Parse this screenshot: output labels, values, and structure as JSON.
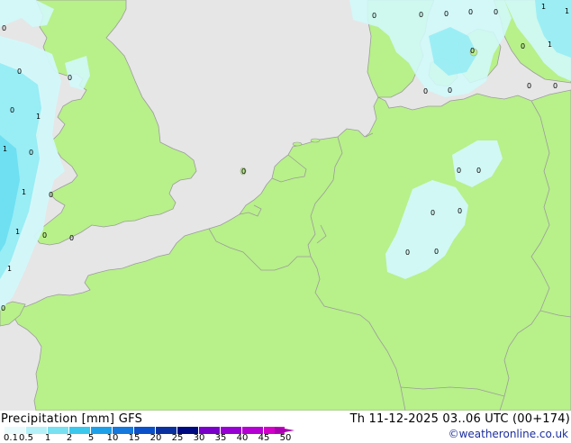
{
  "map": {
    "colors": {
      "sea": "#e6e6e6",
      "land": "#b8f08a",
      "border": "#9c9c9c",
      "precip_light": "#d2f8fa",
      "precip_medium": "#96ecf4",
      "precip_heavy": "#6cdff0"
    },
    "value_labels": [
      "1",
      "1",
      "1",
      "1",
      "1",
      "1",
      "1",
      "1",
      "0",
      "0",
      "0",
      "0",
      "0",
      "0",
      "0",
      "0",
      "0",
      "0",
      "0",
      "0",
      "0",
      "0",
      "0",
      "0",
      "0",
      "0",
      "0",
      "0",
      "0",
      "0"
    ]
  },
  "footer": {
    "title_left": "Precipitation [mm]  GFS",
    "title_right": "Th 11-12-2025 03..06 UTC (00+174)",
    "credit": "©weatheronline.co.uk",
    "scale": {
      "labels": [
        "0.1",
        "0.5",
        "1",
        "2",
        "5",
        "10",
        "15",
        "20",
        "25",
        "30",
        "35",
        "40",
        "45",
        "50"
      ],
      "colors": [
        "#e8fafc",
        "#b4f0f8",
        "#78e0f0",
        "#3cc8ec",
        "#1ea0e8",
        "#1478dc",
        "#0a50c8",
        "#0a30a0",
        "#000a80",
        "#7800c8",
        "#9600d2",
        "#b400d2",
        "#d200c8"
      ]
    }
  }
}
